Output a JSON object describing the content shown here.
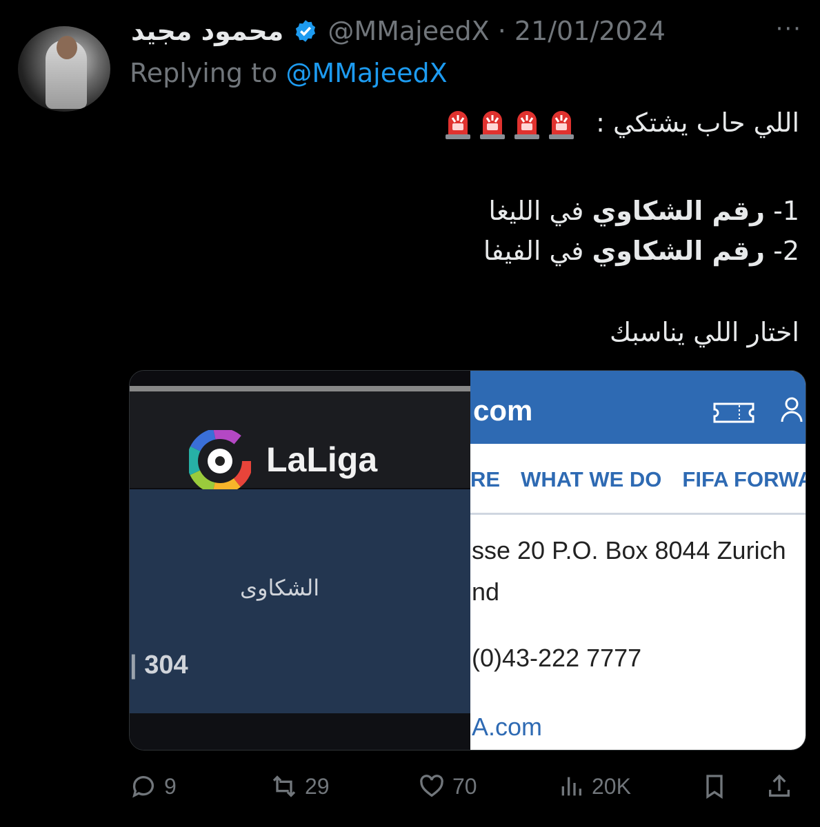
{
  "author": {
    "display_name": "محمود مجيد",
    "handle_date": "@MMajeedX · 21/01/2024",
    "more_label": "···"
  },
  "reply": {
    "prefix": "Replying to ",
    "mention": "@MMajeedX"
  },
  "tweet": {
    "line1": "اللي حاب يشتكي :",
    "line2_num": "1- ",
    "line2_bold": "رقم الشكاوي",
    "line2_rest": " في الليغا",
    "line3_num": "2- ",
    "line3_bold": "رقم الشكاوي",
    "line3_rest": " في الفيفا",
    "line4": "اختار اللي يناسبك"
  },
  "media": {
    "left": {
      "logo_text": "LaLiga",
      "complaints_label": "الشكاوى",
      "number": "304"
    },
    "right": {
      "domain": "com",
      "nav": [
        "RE",
        "WHAT WE DO",
        "FIFA FORWA"
      ],
      "address_line1": "sse 20 P.O. Box 8044 Zurich",
      "address_line2": "nd",
      "phone": "(0)43-222 7777",
      "link": "A.com"
    }
  },
  "actions": {
    "replies": "9",
    "reposts": "29",
    "likes": "70",
    "views": "20K"
  },
  "colors": {
    "background": "#000000",
    "text": "#e7e9ea",
    "muted": "#71767b",
    "accent": "#1d9bf0",
    "fifa_blue": "#2e6ab3",
    "laliga_navy": "#233650"
  }
}
